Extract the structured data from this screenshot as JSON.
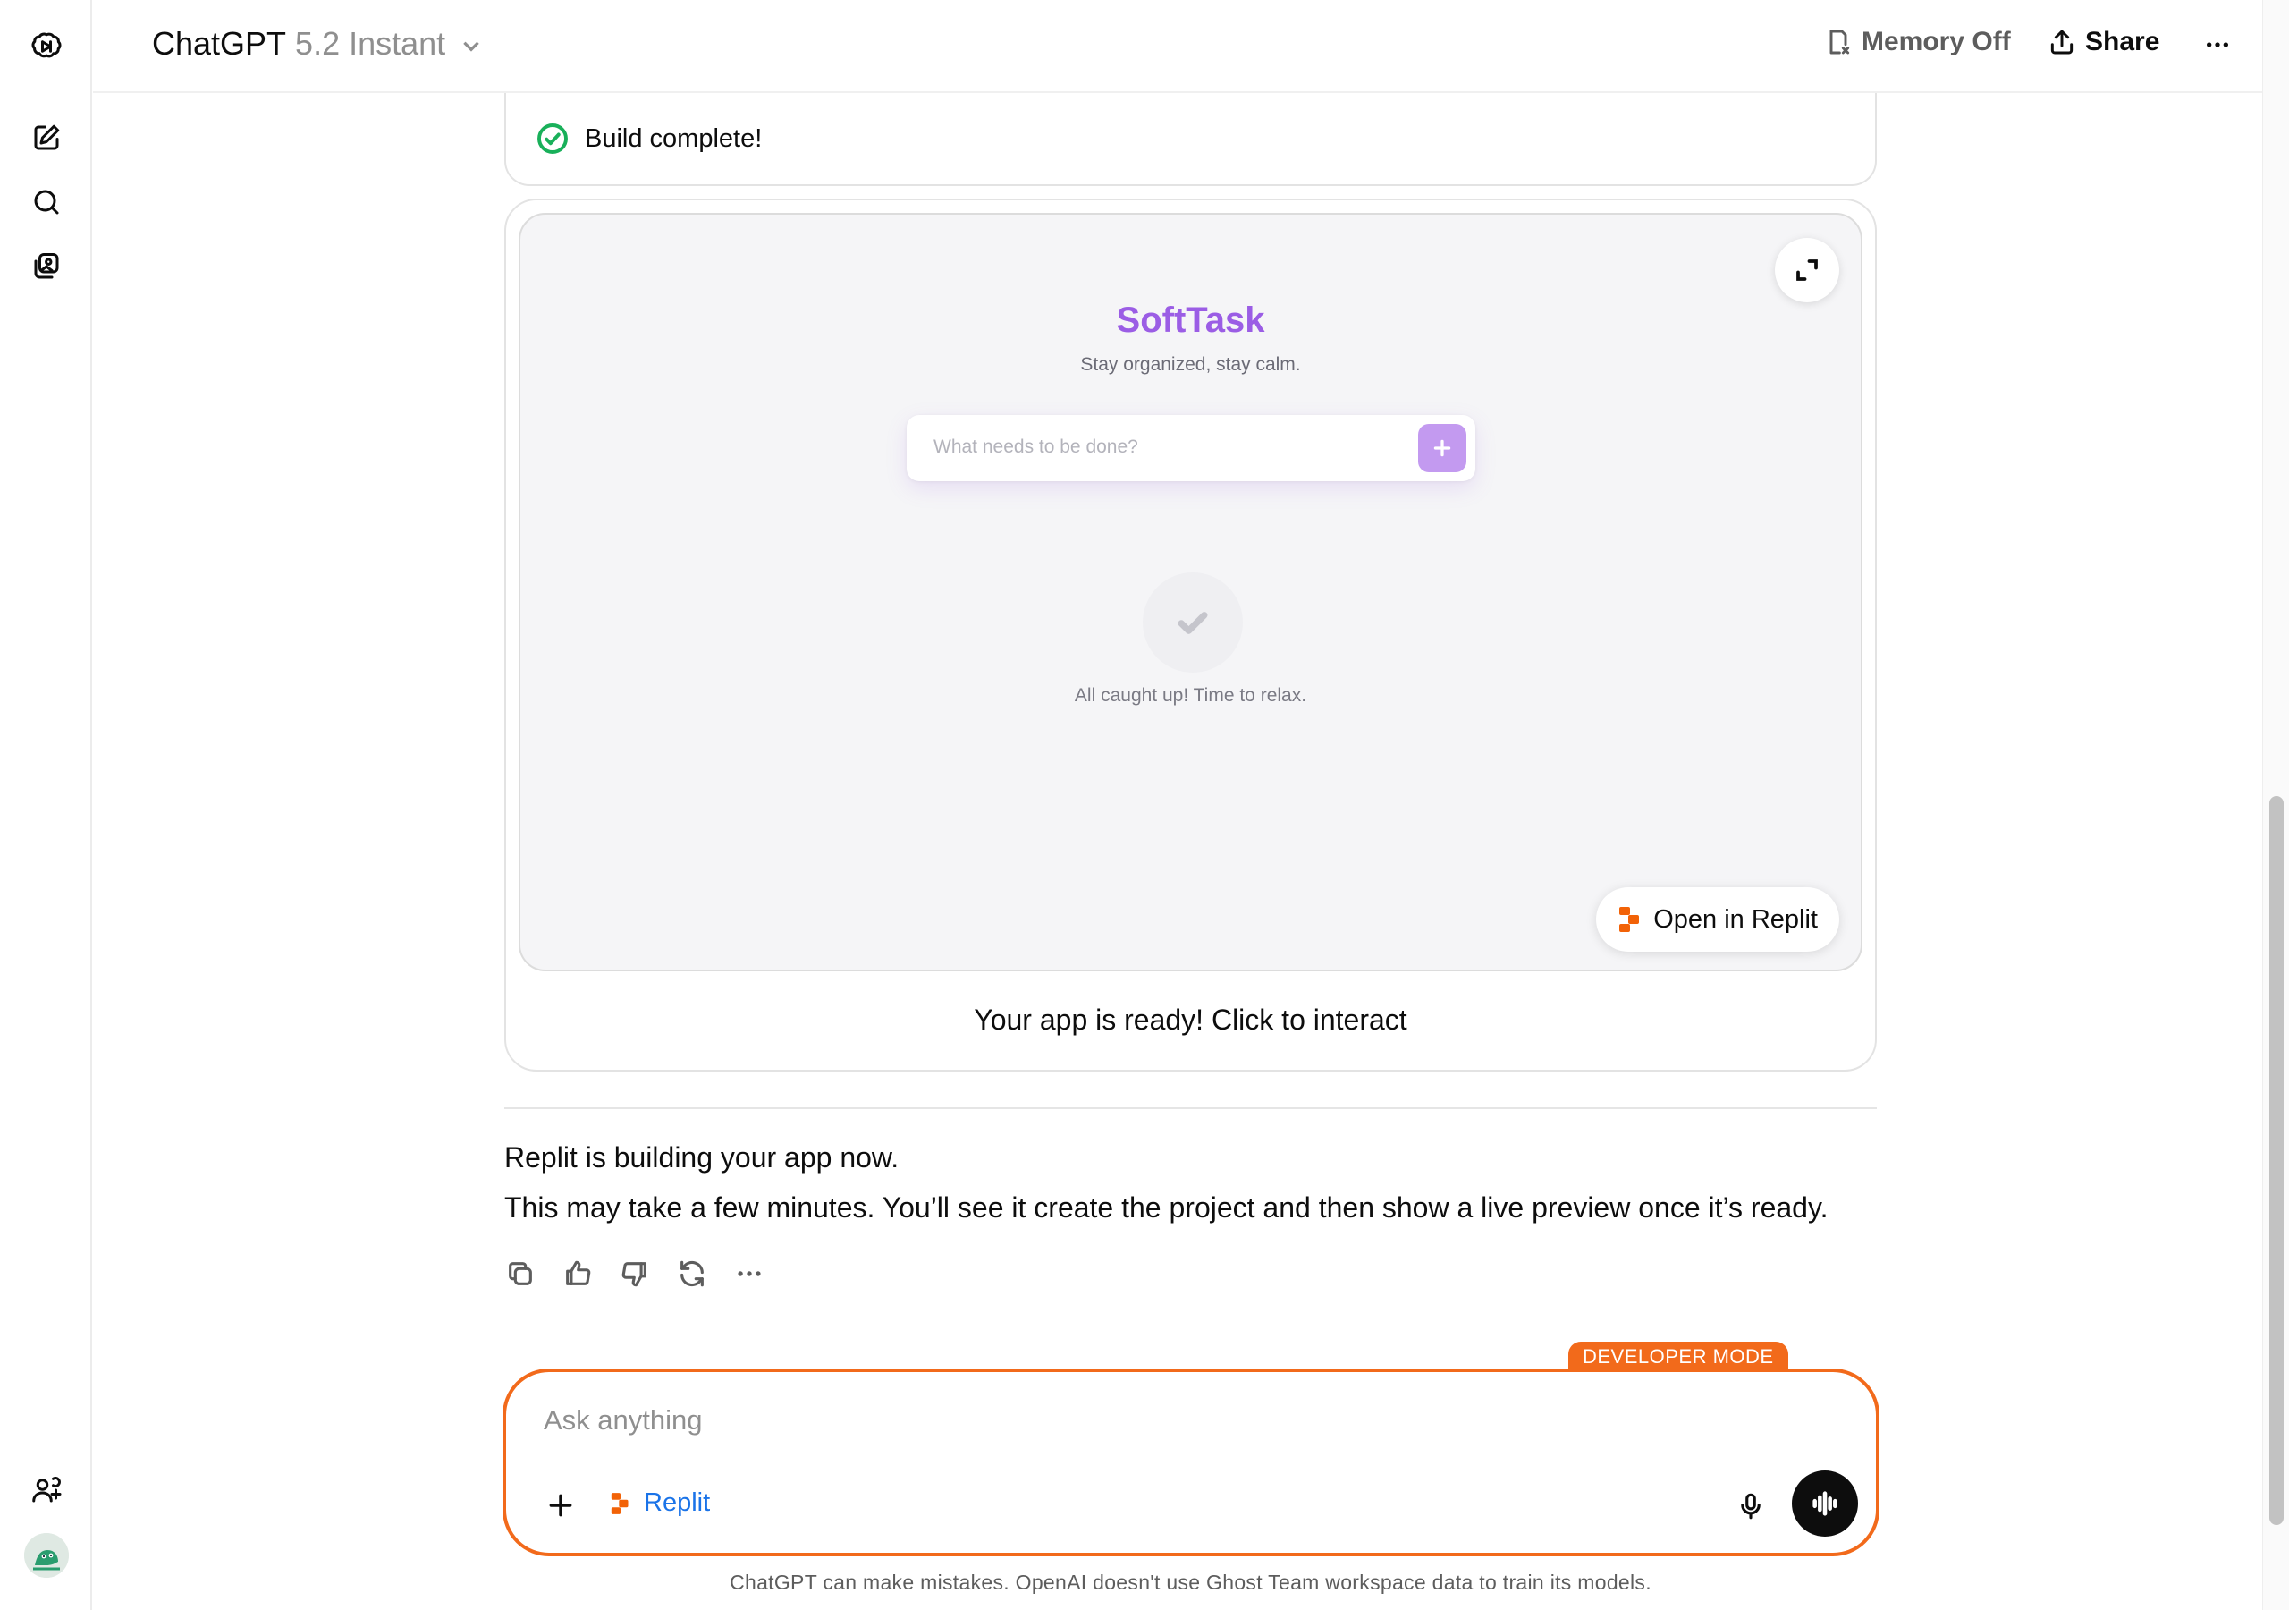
{
  "header": {
    "app_name": "ChatGPT",
    "model_version": "5.2 Instant",
    "memory_label": "Memory Off",
    "share_label": "Share"
  },
  "rail": {
    "icons": [
      "openai-logo-icon",
      "new-chat-icon",
      "search-icon",
      "images-icon",
      "invite-members-icon",
      "avatar"
    ]
  },
  "build_status": {
    "label": "Build complete!",
    "color": "#19b05a"
  },
  "app_preview": {
    "title": "SoftTask",
    "subtitle": "Stay organized, stay calm.",
    "input_placeholder": "What needs to be done?",
    "empty_state": "All caught up! Time to relax.",
    "open_button": "Open in Replit",
    "caption": "Your app is ready! Click to interact",
    "accent": "#9b5de5"
  },
  "message": {
    "line1": "Replit is building your app now.",
    "line2": "This may take a few minutes. You’ll see it create the project and then show a live preview once it’s ready."
  },
  "message_actions": [
    "copy-icon",
    "thumbs-up-icon",
    "thumbs-down-icon",
    "regenerate-icon",
    "more-icon"
  ],
  "composer": {
    "badge": "DEVELOPER MODE",
    "placeholder": "Ask anything",
    "tool_label": "Replit",
    "border_color": "#f26a1b"
  },
  "footer": {
    "disclaimer": "ChatGPT can make mistakes. OpenAI doesn't use Ghost Team workspace data to train its models."
  }
}
